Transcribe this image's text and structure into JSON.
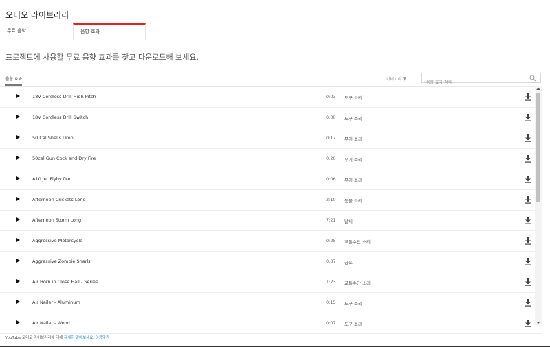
{
  "page": {
    "title": "오디오 라이브러리",
    "subtitle": "프로젝트에 사용할 무료 음향 효과를 찾고 다운로드해 보세요."
  },
  "tabs": [
    {
      "label": "무료 음악"
    },
    {
      "label": "음향 효과"
    }
  ],
  "filter": {
    "active_tab": "음향 효과",
    "category_label": "카테고리",
    "search_placeholder": "음향 효과 검색"
  },
  "colors": {
    "active_tab_accent": "#e62117",
    "link": "#2793e6"
  },
  "rows": [
    {
      "name": "18V Cordless Drill High Pitch",
      "duration": "0:03",
      "category": "도구 소리"
    },
    {
      "name": "18V Cordless Drill Switch",
      "duration": "0:00",
      "category": "도구 소리"
    },
    {
      "name": "50 Cal Shells Drop",
      "duration": "0:17",
      "category": "무기 소리"
    },
    {
      "name": "50cal Gun Cock and Dry Fire",
      "duration": "0:20",
      "category": "무기 소리"
    },
    {
      "name": "A10 Jet Flyby fire",
      "duration": "0:06",
      "category": "무기 소리"
    },
    {
      "name": "Afternoon Crickets Long",
      "duration": "2:10",
      "category": "동물 소리"
    },
    {
      "name": "Afternoon Storm Long",
      "duration": "7:21",
      "category": "날씨"
    },
    {
      "name": "Aggressive Motorcycle",
      "duration": "0:25",
      "category": "교통수단 소리"
    },
    {
      "name": "Aggressive Zombie Snarls",
      "duration": "0:07",
      "category": "공포"
    },
    {
      "name": "Air Horn in Close Hall - Series",
      "duration": "1:23",
      "category": "교통수단 소리"
    },
    {
      "name": "Air Nailer - Aluminum",
      "duration": "0:15",
      "category": "도구 소리"
    },
    {
      "name": "Air Nailer - Wood",
      "duration": "0:07",
      "category": "도구 소리"
    }
  ],
  "footer": {
    "text": "YouTube 오디오 라이브러리에 대해 ",
    "learn_more": "자세히 알아보세요",
    "separator": ". ",
    "terms": "이용약관"
  }
}
